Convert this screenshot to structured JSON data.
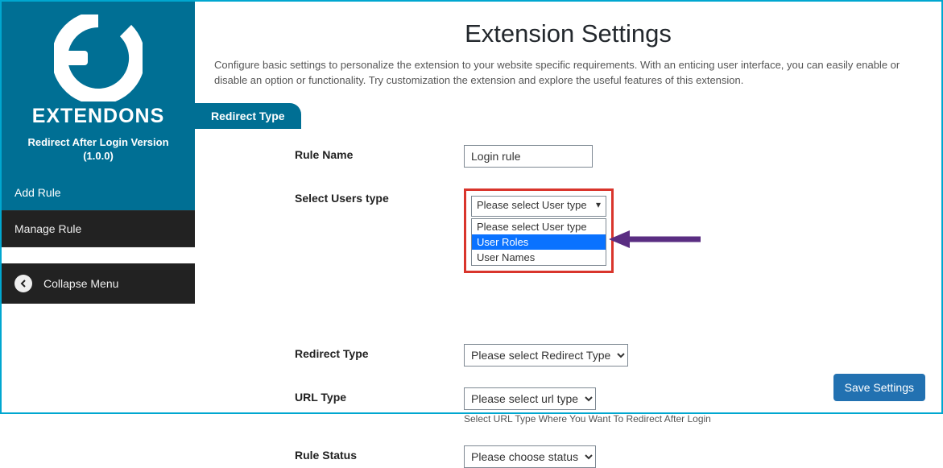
{
  "sidebar": {
    "brand_name": "EXTENDONS",
    "brand_sub_line1": "Redirect After Login Version",
    "brand_sub_line2": "(1.0.0)",
    "menu": [
      {
        "label": "Add Rule",
        "active": true
      },
      {
        "label": "Manage Rule",
        "active": false
      }
    ],
    "collapse_label": "Collapse Menu"
  },
  "page": {
    "title": "Extension Settings",
    "description": "Configure basic settings to personalize the extension to your website specific requirements. With an enticing user interface, you can easily enable or disable an option or functionality. Try customization the extension and explore the useful features of this extension.",
    "tab_label": "Redirect Type"
  },
  "form": {
    "rule_name": {
      "label": "Rule Name",
      "value": "Login rule"
    },
    "users_type": {
      "label": "Select Users type",
      "selected": "Please select User type",
      "options": [
        "Please select User type",
        "User Roles",
        "User Names"
      ],
      "highlighted_index": 1
    },
    "redirect_type": {
      "label": "Redirect Type",
      "selected": "Please select Redirect Type"
    },
    "url_type": {
      "label": "URL Type",
      "selected": "Please select url type",
      "helper": "Select URL Type Where You Want To Redirect After Login"
    },
    "rule_status": {
      "label": "Rule Status",
      "selected": "Please choose status"
    }
  },
  "buttons": {
    "save": "Save Settings"
  },
  "colors": {
    "brand": "#006f94",
    "highlight": "#d9352c",
    "arrow": "#5a2d82",
    "save": "#2271b1"
  }
}
